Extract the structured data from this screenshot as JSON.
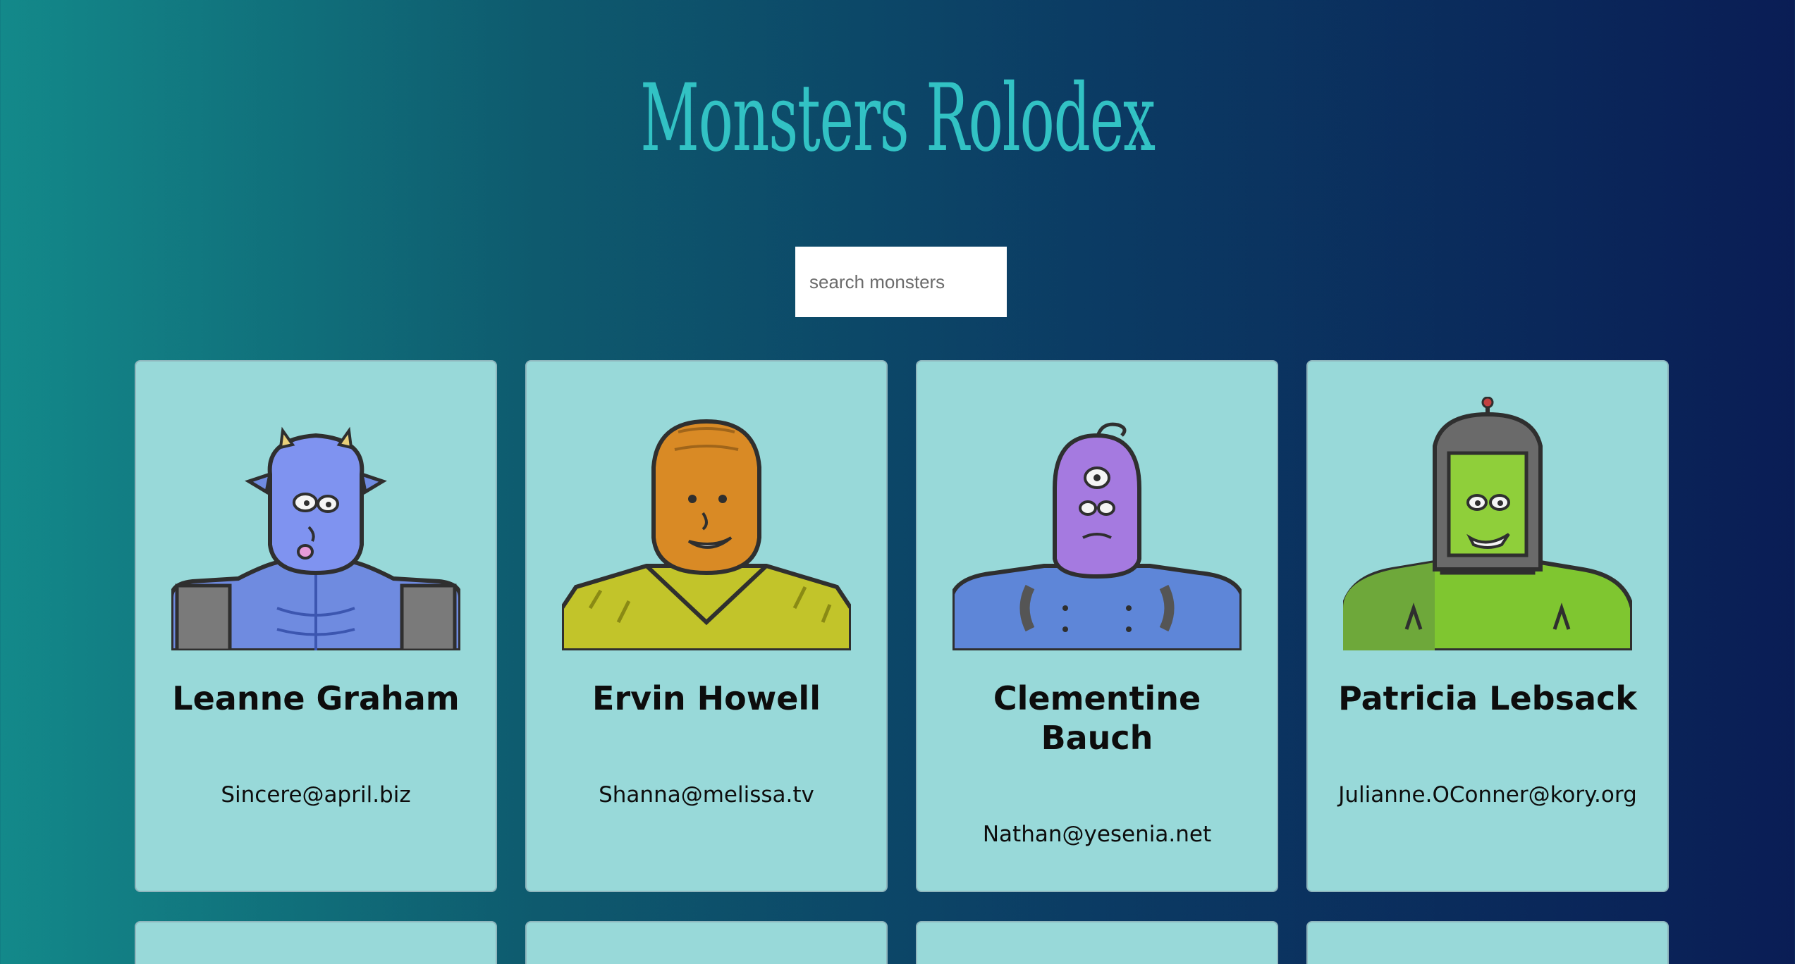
{
  "app": {
    "title": "Monsters Rolodex"
  },
  "search": {
    "placeholder": "search monsters",
    "value": ""
  },
  "monsters": [
    {
      "name": "Leanne Graham",
      "email": "Sincere@april.biz",
      "color": "#7f93f0"
    },
    {
      "name": "Ervin Howell",
      "email": "Shanna@melissa.tv",
      "color": "#d98a25"
    },
    {
      "name": "Clementine Bauch",
      "email": "Nathan@yesenia.net",
      "color": "#a57ae0"
    },
    {
      "name": "Patricia Lebsack",
      "email": "Julianne.OConner@kory.org",
      "color": "#8fcf3a"
    }
  ],
  "colors": {
    "card_bg": "#98d9d9",
    "title": "#32c2c4",
    "gradient_start": "#13898a",
    "gradient_end": "#0a1d55"
  }
}
